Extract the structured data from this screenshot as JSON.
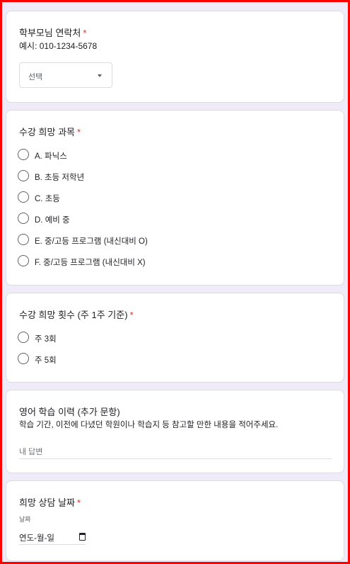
{
  "q1": {
    "title": "학부모님 연락처",
    "required": "*",
    "desc": "예시: 010-1234-5678",
    "select_value": "선택"
  },
  "q2": {
    "title": "수강 희망 과목",
    "required": "*",
    "options": [
      "A. 파닉스",
      "B. 초등 저학년",
      "C. 초등",
      "D. 예비 중",
      "E. 중/고등 프로그램 (내신대비 O)",
      "F. 중/고등 프로그램 (내신대비 X)"
    ]
  },
  "q3": {
    "title": "수강 희망 횟수 (주 1주 기준)",
    "required": "*",
    "options": [
      "주 3회",
      "주 5회"
    ]
  },
  "q4": {
    "title": "영어 학습 이력 (추가 문항)",
    "desc": "학습 기간, 이전에 다녔던 학원이나 학습지 등 참고할 만한 내용을 적어주세요.",
    "placeholder": "내 답변"
  },
  "q5": {
    "title": "희망 상담 날짜",
    "required": "*",
    "date_label": "날짜",
    "date_placeholder": "연도-월-일"
  }
}
